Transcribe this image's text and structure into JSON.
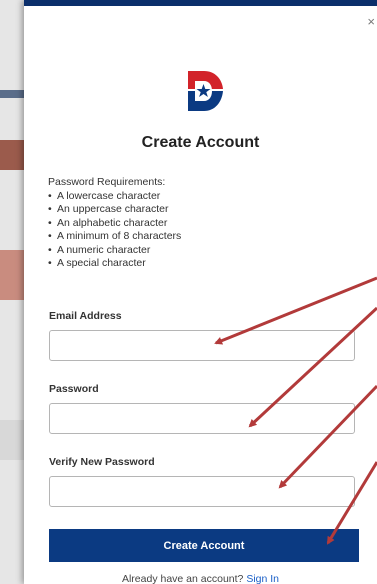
{
  "modal": {
    "close_glyph": "×",
    "title": "Create Account",
    "logo_icon": "d-star-logo-icon"
  },
  "requirements": {
    "heading": "Password Requirements:",
    "items": [
      "A lowercase character",
      "An uppercase character",
      "An alphabetic character",
      "A minimum of 8 characters",
      "A numeric character",
      "A special character"
    ]
  },
  "form": {
    "email_label": "Email Address",
    "email_value": "",
    "password_label": "Password",
    "password_value": "",
    "verify_label": "Verify New Password",
    "verify_value": "",
    "submit_label": "Create Account"
  },
  "footer": {
    "prompt": "Already have an account?",
    "sign_in_link": "Sign In"
  },
  "colors": {
    "brand_navy": "#0b3a82",
    "logo_red": "#d2232a",
    "annotation_arrow": "#b23a3a",
    "link": "#1a5fc7"
  }
}
